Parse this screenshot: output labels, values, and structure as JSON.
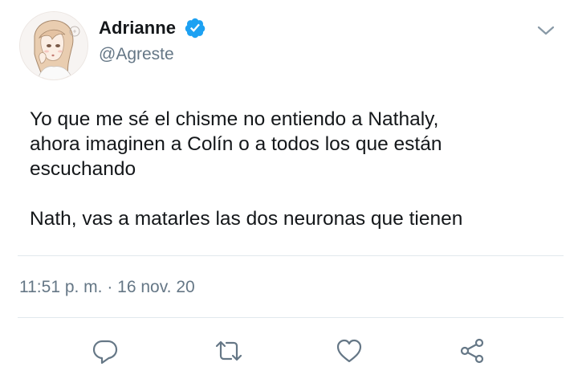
{
  "user": {
    "display_name": "Adrianne",
    "handle": "@Agreste",
    "verified": true
  },
  "tweet": {
    "paragraphs": [
      "Yo que me sé el chisme no entiendo a Nathaly,",
      "ahora imaginen a Colín o a todos los que están",
      "escuchando",
      "Nath, vas a matarles las dos neuronas que tienen"
    ],
    "timestamp": "11:51 p. m. · 16 nov. 20"
  },
  "icons": {
    "more": "chevron-down-icon",
    "reply": "reply-icon",
    "retweet": "retweet-icon",
    "like": "heart-icon",
    "share": "share-icon"
  },
  "colors": {
    "verified": "#1da1f2",
    "secondary_text": "#657786",
    "primary_text": "#14171a",
    "divider": "#e1e8ed"
  }
}
